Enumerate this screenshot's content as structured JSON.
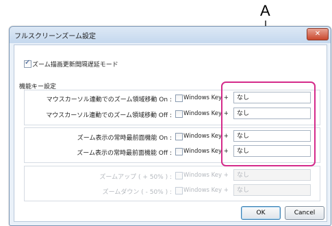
{
  "callout_label": "A",
  "window": {
    "title": "フルスクリーンズーム設定",
    "close_glyph": "✕"
  },
  "delay_mode": {
    "label": "ズーム描画更新間隔遅延モード",
    "checked": true
  },
  "section_title": "機能キー設定",
  "win_key_label": "Windows Key +",
  "rows": [
    {
      "label": "マウスカーソル連動でのズーム領域移動 On :",
      "value": "なし",
      "enabled": true
    },
    {
      "label": "マウスカーソル連動でのズーム領域移動 Off :",
      "value": "なし",
      "enabled": true
    },
    {
      "label": "ズーム表示の常時最前面機能 On :",
      "value": "なし",
      "enabled": true
    },
    {
      "label": "ズーム表示の常時最前面機能 Off :",
      "value": "なし",
      "enabled": true
    },
    {
      "label": "ズームアップ ( + 50% ) :",
      "value": "なし",
      "enabled": false
    },
    {
      "label": "ズームダウン ( - 50% ) :",
      "value": "なし",
      "enabled": false
    }
  ],
  "buttons": {
    "ok": "OK",
    "cancel": "Cancel"
  },
  "colors": {
    "highlight": "#d42a8a",
    "accent": "#3c7fb1"
  }
}
